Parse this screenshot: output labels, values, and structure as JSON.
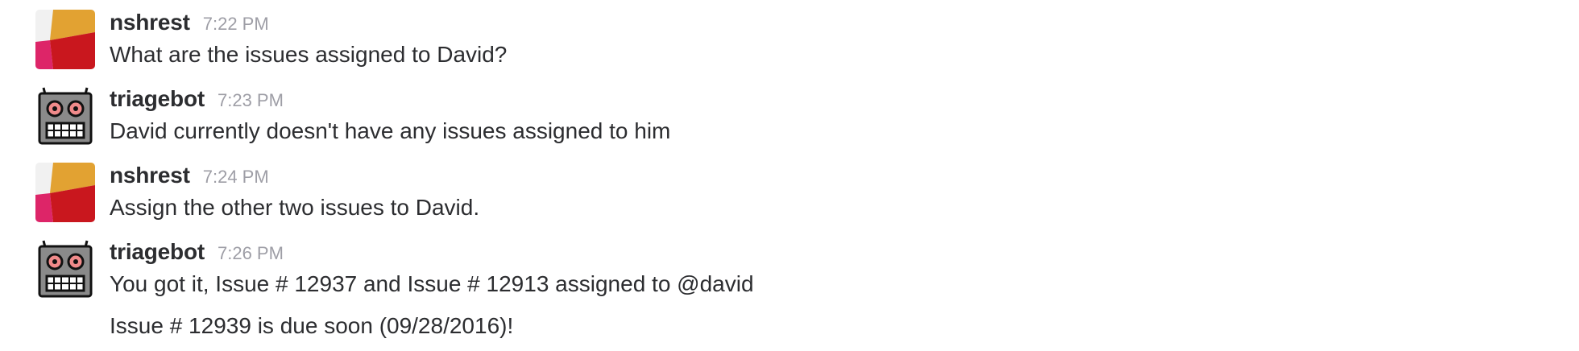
{
  "messages": [
    {
      "user": "nshrest",
      "time": "7:22 PM",
      "avatar": "nshrest-avatar",
      "lines": [
        "What are the issues assigned to David?"
      ]
    },
    {
      "user": "triagebot",
      "time": "7:23 PM",
      "avatar": "robot-icon",
      "lines": [
        "David currently doesn't have any issues assigned to him"
      ]
    },
    {
      "user": "nshrest",
      "time": "7:24 PM",
      "avatar": "nshrest-avatar",
      "lines": [
        "Assign the other two issues to David."
      ]
    },
    {
      "user": "triagebot",
      "time": "7:26 PM",
      "avatar": "robot-icon",
      "lines": [
        "You got it, Issue # 12937 and Issue # 12913 assigned to @david",
        "Issue # 12939 is due soon (09/28/2016)!"
      ]
    }
  ],
  "colors": {
    "username": "#2c2d30",
    "timestamp": "#9e9ea6",
    "text": "#2c2d30",
    "avatar_orange": "#e2a232",
    "avatar_red": "#c9171e",
    "avatar_pink": "#dd2568",
    "avatar_light": "#f1f1f1",
    "robot_gray": "#8a8a8a",
    "robot_eye": "#f08a8a"
  }
}
